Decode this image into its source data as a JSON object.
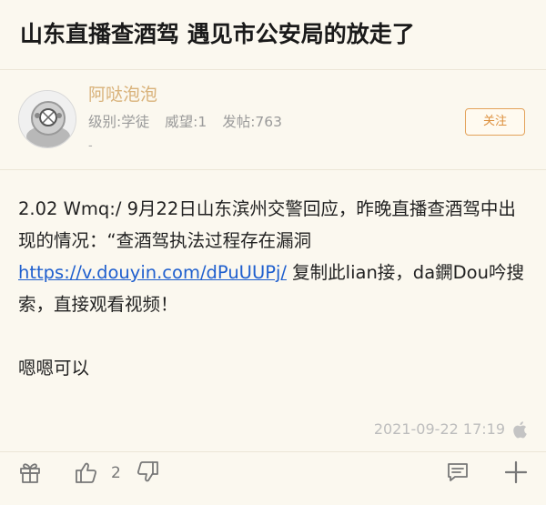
{
  "post": {
    "title": "山东直播查酒驾 遇见市公安局的放走了"
  },
  "author": {
    "name": "阿哒泡泡",
    "level": "级别:学徒",
    "prestige": "威望:1",
    "posts": "发帖:763",
    "extra": "-",
    "follow_label": "关注"
  },
  "content": {
    "line1": "2.02 Wmq:/ 9月22日山东滨州交警回应，昨晚直播查酒驾中出现的情况：“查酒驾执法过程存在漏洞 ",
    "link": "https://v.douyin.com/dPuUUPj/",
    "line2": " 复制此lian接，da鐦Dou吟搜索，直接观看视频！",
    "line3": "嗯嗯可以"
  },
  "footer": {
    "timestamp": "2021-09-22 17:19",
    "like_count": "2"
  },
  "icons": {
    "gift": "gift-icon",
    "like": "thumbs-up-icon",
    "dislike": "thumbs-down-icon",
    "comment": "comment-icon",
    "more": "plus-icon",
    "device": "apple-icon"
  },
  "colors": {
    "background": "#fbf8ef",
    "username": "#d9b27a",
    "follow": "#dd8f3c",
    "link": "#1f5fce"
  }
}
